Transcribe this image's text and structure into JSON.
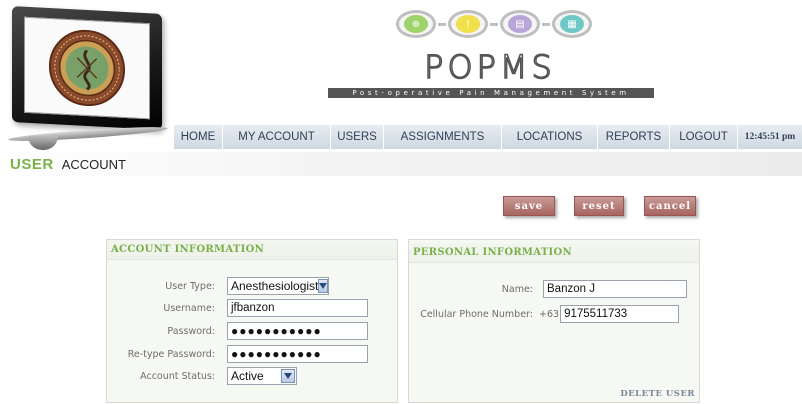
{
  "brand": {
    "title": "POPMS",
    "tagline": "Post-operative Pain Management System",
    "icon_colors": [
      "#9fd26b",
      "#f2e04a",
      "#b9a6d8",
      "#6cc7c6"
    ]
  },
  "nav": {
    "items": [
      "HOME",
      "MY ACCOUNT",
      "USERS",
      "ASSIGNMENTS",
      "LOCATIONS",
      "REPORTS",
      "LOGOUT"
    ],
    "clock": "12:45:51 pm"
  },
  "page": {
    "heading_primary": "USER",
    "heading_secondary": "ACCOUNT"
  },
  "actions": {
    "save": "save",
    "reset": "reset",
    "cancel": "cancel"
  },
  "account_info": {
    "title": "ACCOUNT INFORMATION",
    "user_type_label": "User Type:",
    "user_type_value": "Anesthesiologist",
    "username_label": "Username:",
    "username_value": "jfbanzon",
    "password_label": "Password:",
    "password_value": "●●●●●●●●●●●",
    "retype_label": "Re-type Password:",
    "retype_value": "●●●●●●●●●●●",
    "status_label": "Account Status:",
    "status_value": "Active"
  },
  "personal_info": {
    "title": "PERSONAL INFORMATION",
    "name_label": "Name:",
    "name_value": "Banzon J",
    "phone_label": "Cellular Phone Number:",
    "phone_prefix": "+63",
    "phone_value": "9175511733",
    "delete_label": "DELETE USER"
  },
  "colors": {
    "accent_green": "#7ab04a",
    "button": "#b27470",
    "nav_bg": "#d5dee6"
  }
}
